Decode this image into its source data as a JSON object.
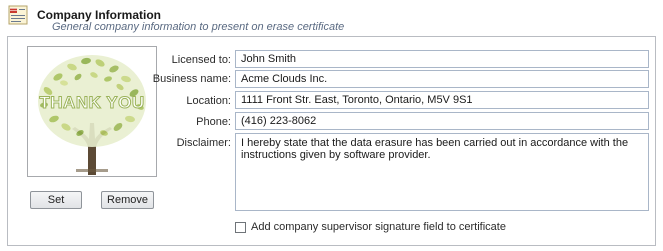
{
  "header": {
    "title": "Company Information",
    "subtitle": "General company information to present on erase certificate",
    "icon": "company-info-icon"
  },
  "logo": {
    "text": "THANK YOU",
    "icon": "thank-you-tree-image"
  },
  "buttons": {
    "set": "Set",
    "remove": "Remove"
  },
  "fields": {
    "licensed_to": {
      "label": "Licensed to:",
      "value": "John Smith"
    },
    "business_name": {
      "label": "Business name:",
      "value": "Acme Clouds Inc."
    },
    "location": {
      "label": "Location:",
      "value": "1111 Front Str. East, Toronto, Ontario, M5V 9S1"
    },
    "phone": {
      "label": "Phone:",
      "value": "(416) 223-8062"
    },
    "disclaimer": {
      "label": "Disclaimer:",
      "value": "I hereby state that the data erasure has been carried out in accordance with the instructions given by software provider."
    }
  },
  "supervisor_checkbox": {
    "label": "Add company supervisor signature field to certificate",
    "checked": false
  },
  "colors": {
    "accent": "#5a6a82",
    "input_border": "#a9b6c8"
  }
}
